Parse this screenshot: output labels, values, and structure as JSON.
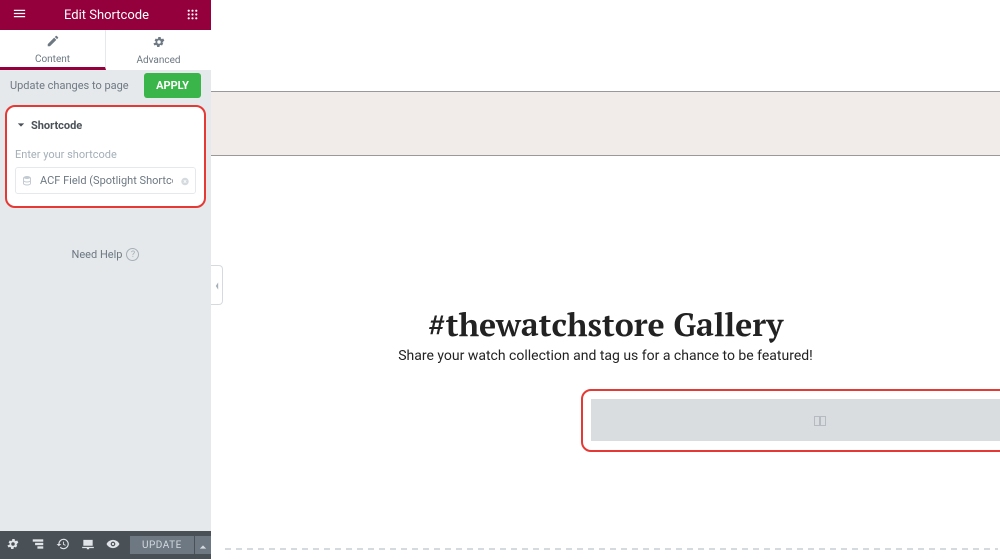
{
  "header": {
    "title": "Edit Shortcode"
  },
  "tabs": {
    "content": "Content",
    "advanced": "Advanced"
  },
  "update_bar": {
    "text": "Update changes to page",
    "apply": "APPLY"
  },
  "shortcode_section": {
    "title": "Shortcode",
    "field_label": "Enter your shortcode",
    "field_value": "ACF Field (Spotlight Shortcode)"
  },
  "help": {
    "text": "Need Help",
    "icon": "?"
  },
  "footer": {
    "update": "UPDATE"
  },
  "canvas": {
    "heading": "#thewatchstore Gallery",
    "subheading": "Share your watch collection and tag us for a chance to be featured!"
  }
}
